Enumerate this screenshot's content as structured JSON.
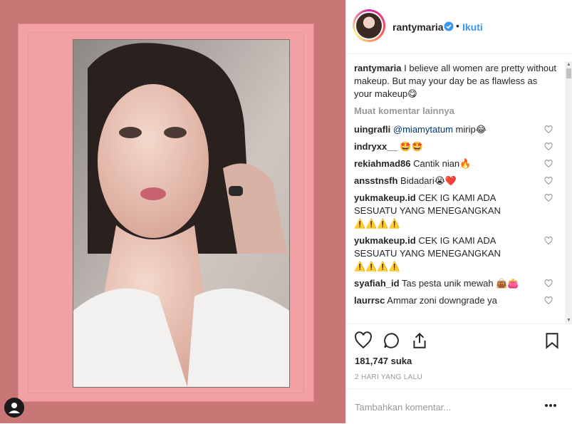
{
  "post": {
    "username": "rantymaria",
    "follow_label": "Ikuti",
    "separator": "•",
    "caption_user": "rantymaria",
    "caption_text": "I believe all women are pretty without makeup. But may your day be as flawless as your makeup😋",
    "load_more": "Muat komentar lainnya",
    "likes": "181,747 suka",
    "timestamp": "2 HARI YANG LALU",
    "add_comment_placeholder": "Tambahkan komentar...",
    "comments": [
      {
        "user": "uingrafli",
        "mention": "@miamytatum",
        "text": " mirip😂"
      },
      {
        "user": "indryxx__",
        "mention": "",
        "text": "🤩🤩"
      },
      {
        "user": "rekiahmad86",
        "mention": "",
        "text": "Cantik nian🔥"
      },
      {
        "user": "ansstnsfh",
        "mention": "",
        "text": "Bidadari😭❤️"
      },
      {
        "user": "yukmakeup.id",
        "mention": "",
        "text": "CEK IG KAMI ADA SESUATU YANG MENEGANGKAN ⚠️⚠️⚠️⚠️"
      },
      {
        "user": "yukmakeup.id",
        "mention": "",
        "text": "CEK IG KAMI ADA SESUATU YANG MENEGANGKAN ⚠️⚠️⚠️⚠️"
      },
      {
        "user": "syafiah_id",
        "mention": "",
        "text": "Tas pesta unik mewah 👜👛"
      },
      {
        "user": "laurrsc",
        "mention": "",
        "text": "Ammar zoni downgrade ya"
      }
    ]
  },
  "icons": {
    "like": "heart-icon",
    "comment": "comment-icon",
    "share": "share-icon",
    "save": "bookmark-icon",
    "options": "more-options-icon",
    "verified": "verified-badge-icon"
  },
  "colors": {
    "background": "#c87676",
    "frame": "#f2a0a3",
    "link": "#3897f0",
    "muted": "#999999"
  }
}
